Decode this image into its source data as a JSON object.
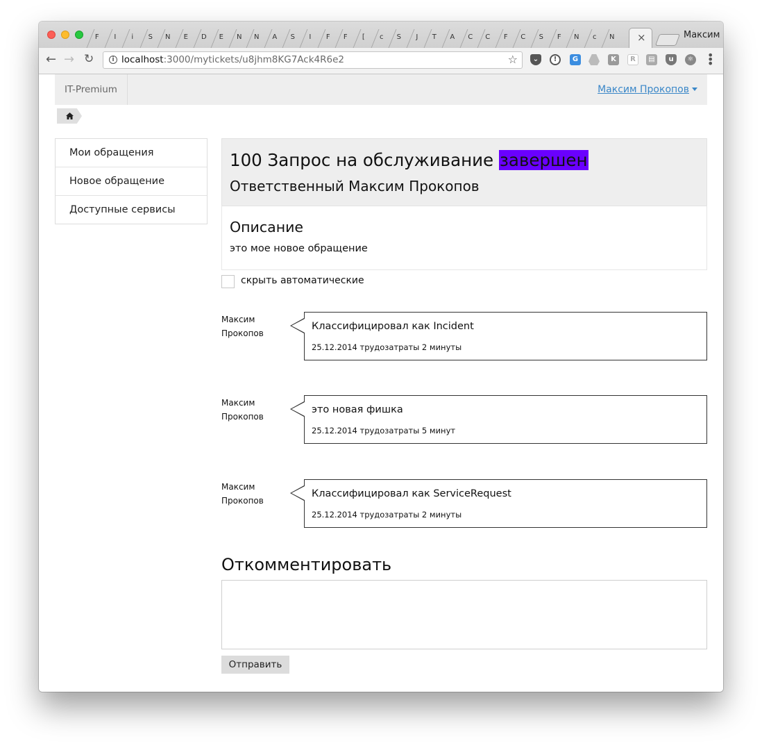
{
  "browser": {
    "profile_name": "Максим",
    "tab_glyphs": [
      "F",
      "I",
      "i",
      "S",
      "N",
      "E",
      "D",
      "E",
      "N",
      "N",
      "A",
      "S",
      "I",
      "F",
      "F",
      "[",
      "c",
      "S",
      "J",
      "T",
      "A",
      "C",
      "C",
      "F",
      "C",
      "S",
      "F",
      "N",
      "c",
      "N"
    ],
    "close_glyph": "×",
    "url_host": "localhost",
    "url_path": ":3000/mytickets/u8jhm8KG7Ack4R6e2",
    "icons": [
      "back-arrow-icon",
      "forward-arrow-icon",
      "reload-icon",
      "info-icon",
      "star-icon",
      "pocket-icon",
      "onepassword-icon",
      "extension-icon",
      "drive-icon",
      "kaspersky-icon",
      "readability-icon",
      "feed-icon",
      "ublock-icon",
      "react-icon",
      "menu-icon"
    ]
  },
  "navbar": {
    "brand": "IT-Premium",
    "user": "Максим Прокопов"
  },
  "sidebar": {
    "items": [
      {
        "label": "Мои обращения"
      },
      {
        "label": "Новое обращение"
      },
      {
        "label": "Доступные сервисы"
      }
    ]
  },
  "ticket": {
    "title": "100 Запрос на обслуживание",
    "status": "завершен",
    "status_color": "#6a00ff",
    "responsible": "Ответственный Максим Прокопов",
    "description_title": "Описание",
    "description_text": "это мое новое обращение"
  },
  "filter": {
    "label": "скрыть автоматические",
    "checked": false
  },
  "comments": [
    {
      "author_first": "Максим",
      "author_last": "Прокопов",
      "text": "Классифицировал как Incident",
      "meta": "25.12.2014 трудозатраты 2 минуты"
    },
    {
      "author_first": "Максим",
      "author_last": "Прокопов",
      "text": "это новая фишка",
      "meta": "25.12.2014 трудозатраты 5 минут"
    },
    {
      "author_first": "Максим",
      "author_last": "Прокопов",
      "text": "Классифицировал как ServiceRequest",
      "meta": "25.12.2014 трудозатраты 2 минуты"
    }
  ],
  "comment_form": {
    "title": "Откомментировать",
    "textarea_value": "",
    "submit_label": "Отправить"
  }
}
